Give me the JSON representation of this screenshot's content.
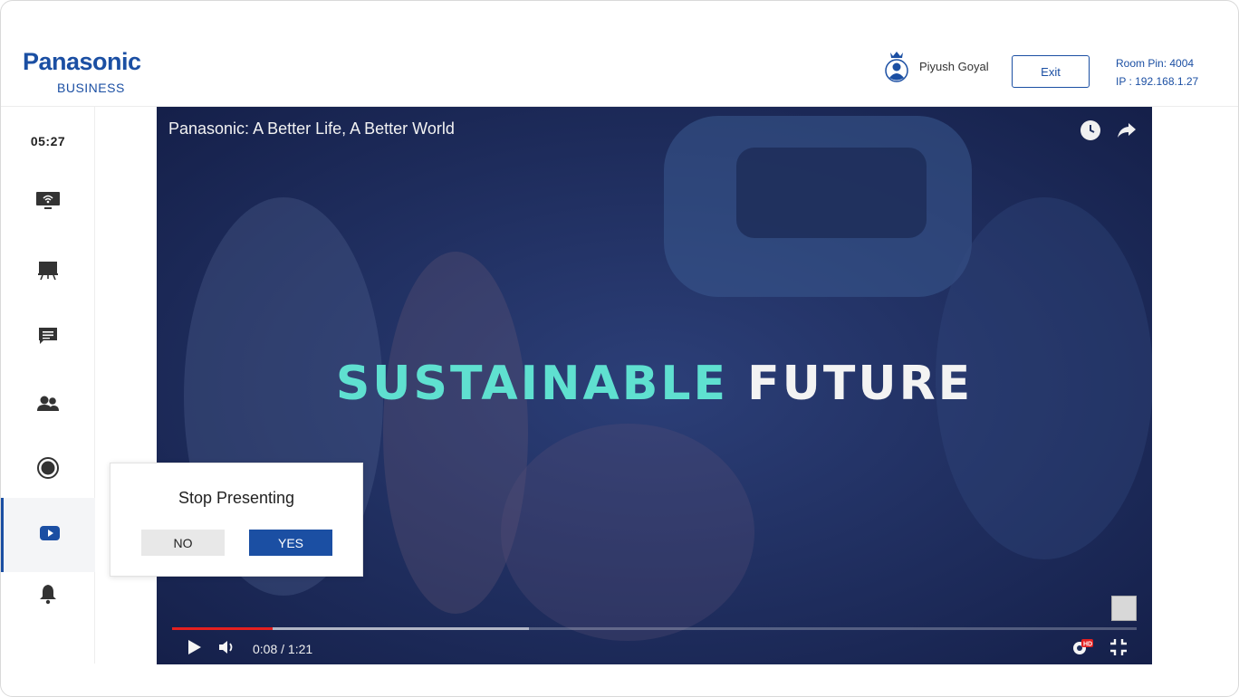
{
  "brand": {
    "name": "Panasonic",
    "subtitle": "BUSINESS",
    "color": "#1b4fa3"
  },
  "header": {
    "user_name": "Piyush Goyal",
    "exit_label": "Exit",
    "room_pin": "Room Pin: 4004",
    "ip": "IP : 192.168.1.27"
  },
  "sidebar": {
    "timer": "05:27",
    "items": [
      {
        "icon": "cast-screen-icon"
      },
      {
        "icon": "whiteboard-icon"
      },
      {
        "icon": "chat-icon"
      },
      {
        "icon": "participants-icon"
      },
      {
        "icon": "record-icon"
      },
      {
        "icon": "youtube-icon",
        "active": true
      },
      {
        "icon": "bell-icon"
      }
    ]
  },
  "video": {
    "title": "Panasonic: A Better Life, A Better World",
    "headline_part1": "SUSTAINABLE",
    "headline_part2": "FUTURE",
    "current_time": "0:08 / 1:21",
    "played_fraction": 0.104,
    "buffered_fraction": 0.37,
    "quality_badge": "HD",
    "accent_color": "#e52020"
  },
  "popup": {
    "title": "Stop Presenting",
    "no_label": "NO",
    "yes_label": "YES"
  }
}
